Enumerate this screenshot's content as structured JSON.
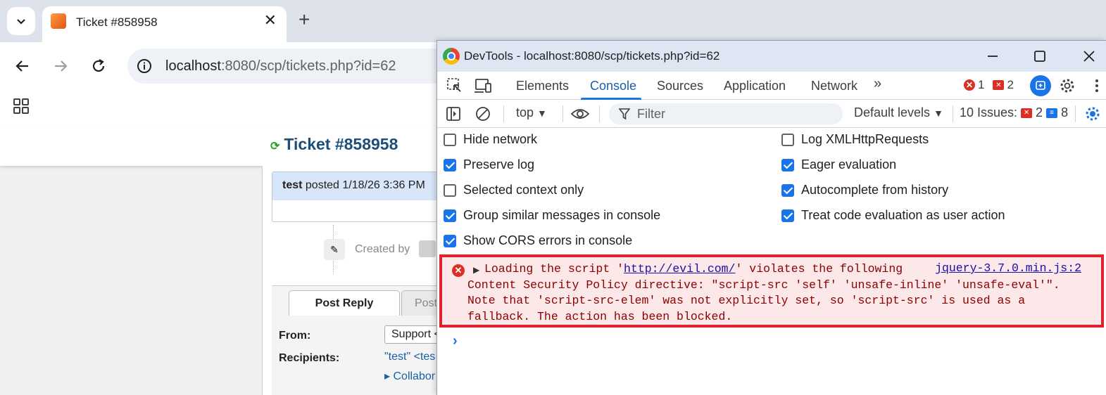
{
  "browser": {
    "tab_title": "Ticket #858958",
    "url_host": "localhost",
    "url_rest": ":8080/scp/tickets.php?id=62"
  },
  "page": {
    "ticket_heading": "Ticket #858958",
    "thread_author": "test",
    "thread_posted": "posted 1/18/26 3:36 PM",
    "created_by": "Created by",
    "reply_tab_active": "Post Reply",
    "reply_tab_inactive": "Post",
    "from_label": "From:",
    "from_value": "Support <",
    "recipients_label": "Recipients:",
    "recipients_value": "\"test\" <tes",
    "collaborators": "Collabor"
  },
  "devtools": {
    "title": "DevTools - localhost:8080/scp/tickets.php?id=62",
    "tabs": [
      "Elements",
      "Console",
      "Sources",
      "Application",
      "Network"
    ],
    "active_tab": "Console",
    "error_count": "1",
    "warning_count": "2",
    "context": "top",
    "filter_placeholder": "Filter",
    "levels": "Default levels",
    "issues_label": "10 Issues:",
    "issues_errors": "2",
    "issues_info": "8",
    "settings_left": [
      {
        "label": "Hide network",
        "checked": false
      },
      {
        "label": "Preserve log",
        "checked": true
      },
      {
        "label": "Selected context only",
        "checked": false
      },
      {
        "label": "Group similar messages in console",
        "checked": true
      },
      {
        "label": "Show CORS errors in console",
        "checked": true
      }
    ],
    "settings_right": [
      {
        "label": "Log XMLHttpRequests",
        "checked": false
      },
      {
        "label": "Eager evaluation",
        "checked": true
      },
      {
        "label": "Autocomplete from history",
        "checked": true
      },
      {
        "label": "Treat code evaluation as user action",
        "checked": true
      }
    ],
    "message": {
      "prefix": "Loading the script '",
      "link": "http://evil.com/",
      "suffix": "' violates the following",
      "line2": "Content Security Policy directive: \"script-src 'self' 'unsafe-inline' 'unsafe-eval'\".",
      "line3": "Note that 'script-src-elem' was not explicitly set, so 'script-src' is used as a",
      "line4": "fallback. The action has been blocked.",
      "source": "jquery-3.7.0.min.js:2"
    }
  },
  "colors": {
    "accent": "#1a73e8",
    "error": "#d93025",
    "highlight_border": "#e0222e"
  }
}
